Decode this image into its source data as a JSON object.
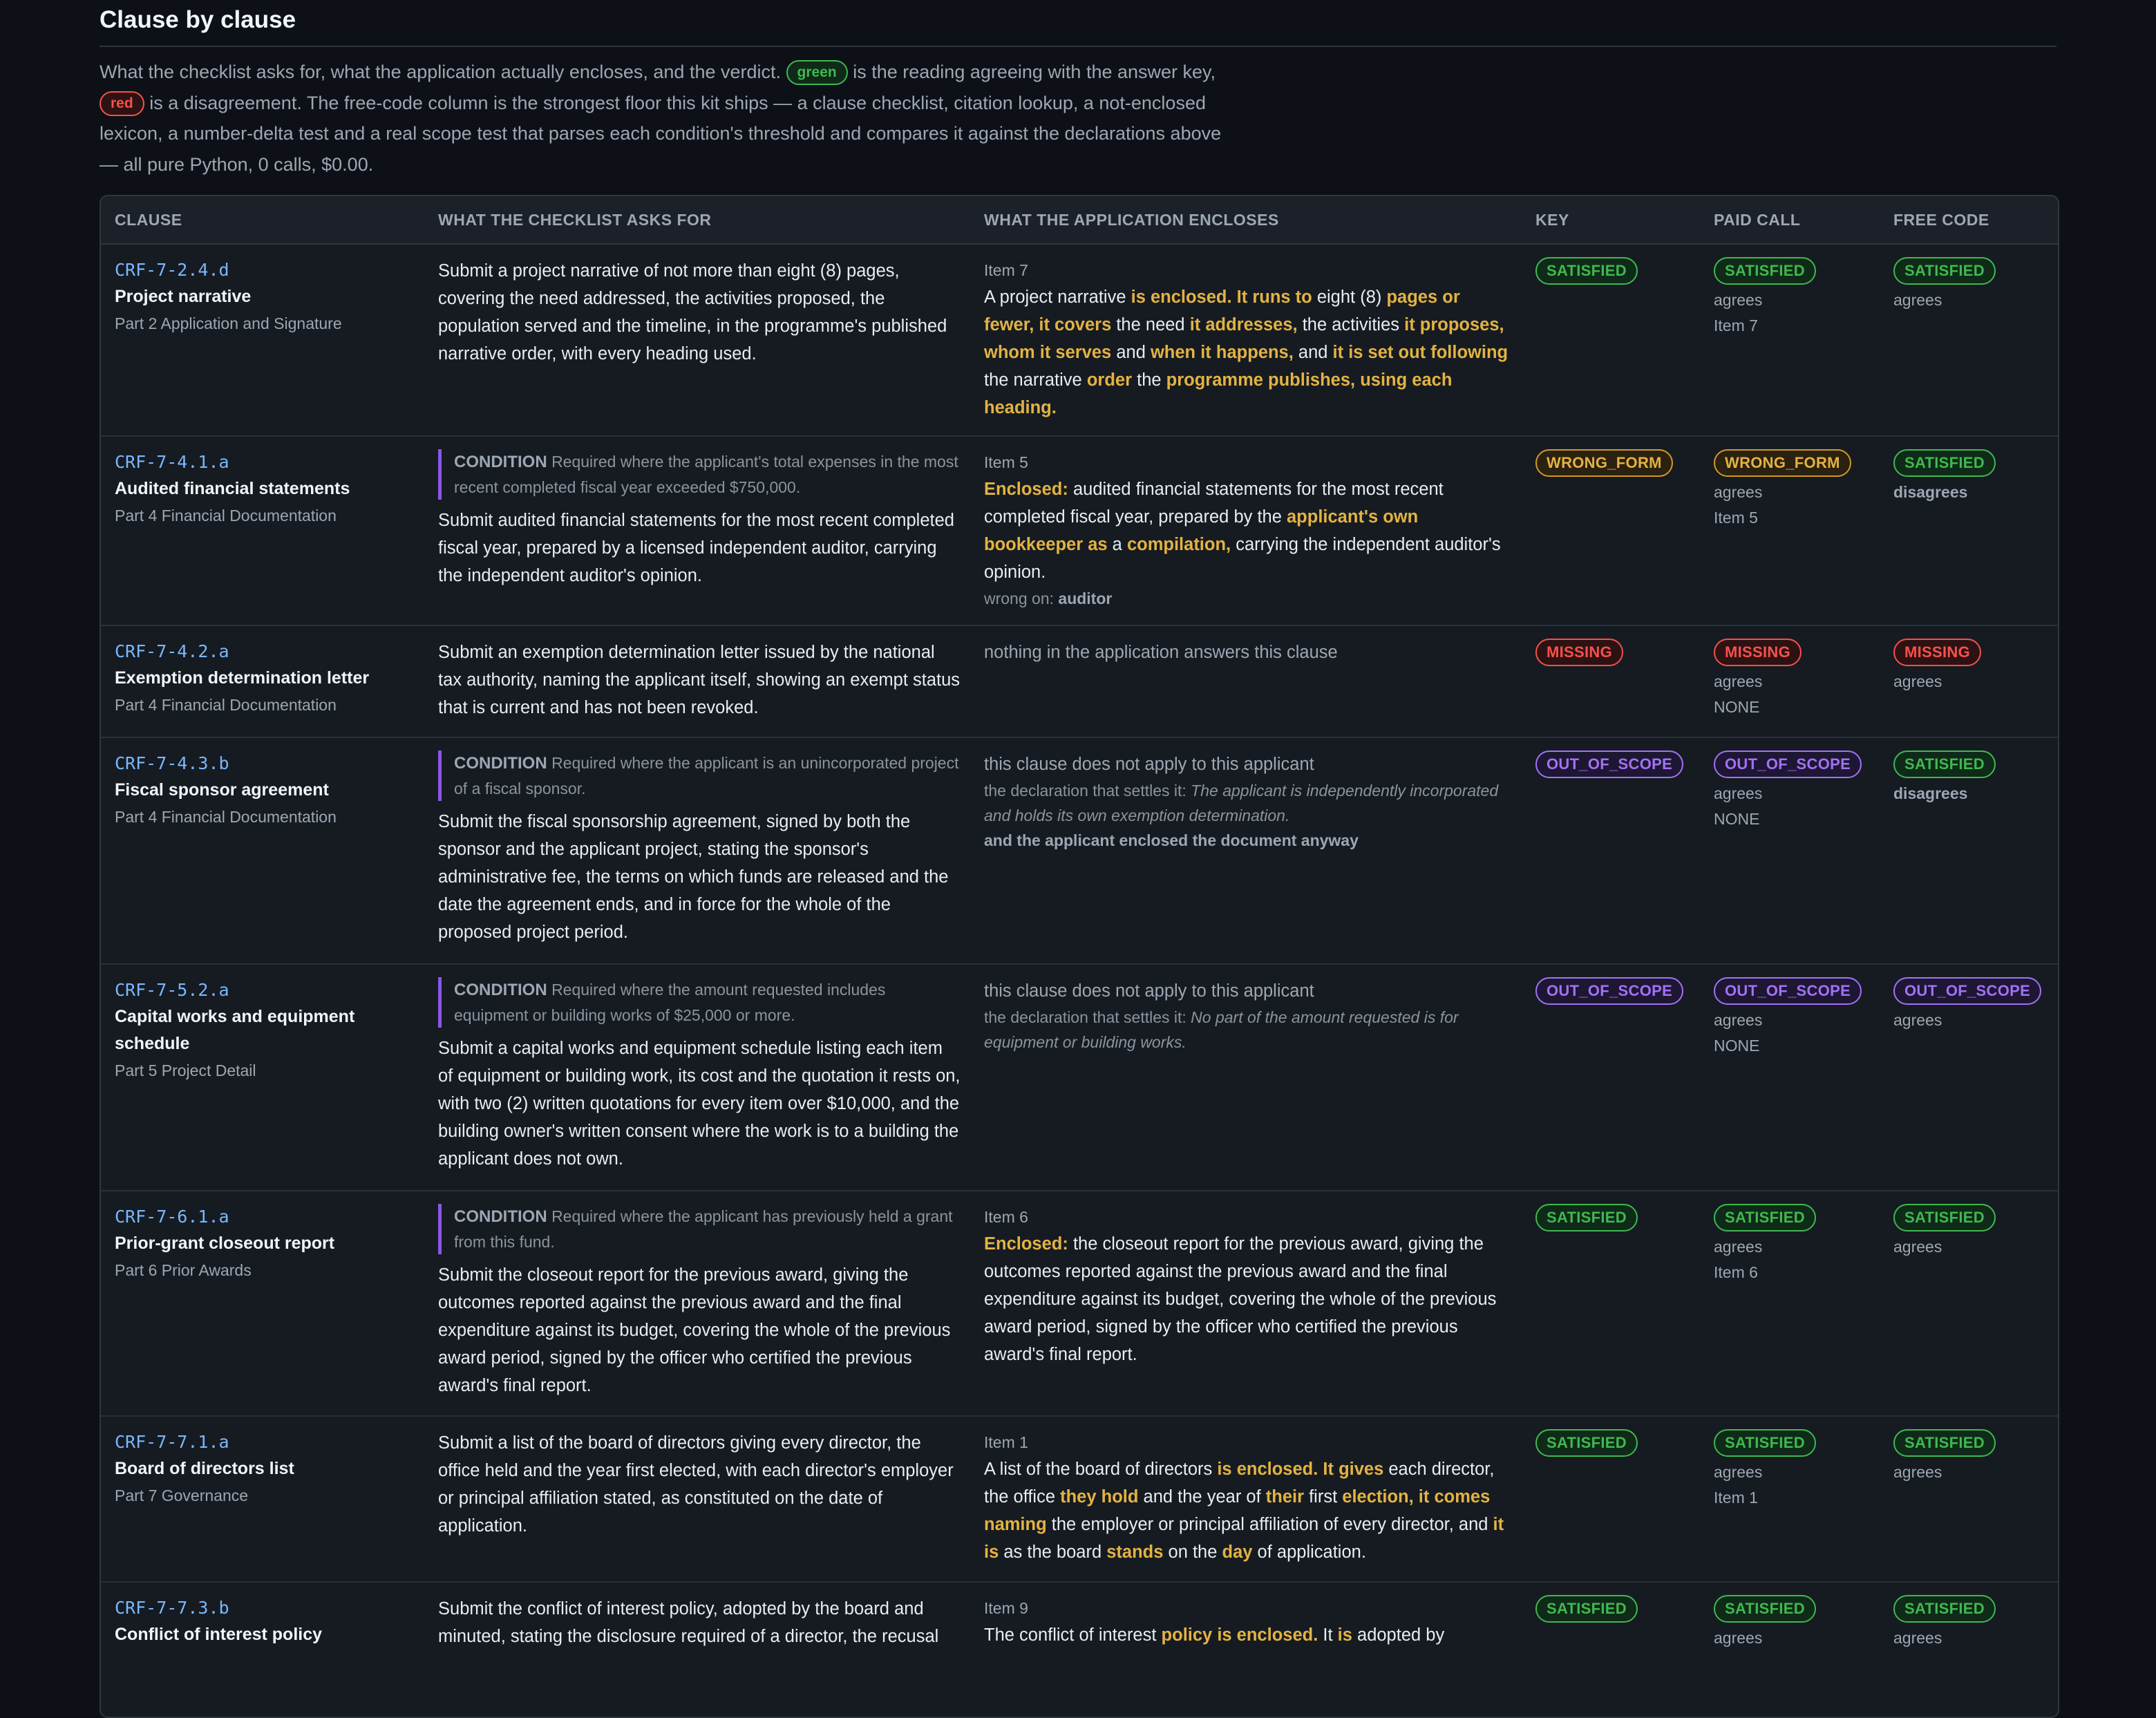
{
  "heading": "Clause by clause",
  "intro": {
    "p1": "What the checklist asks for, what the application actually encloses, and the verdict.",
    "green_chip": "green",
    "p2": "is the reading agreeing with the answer key,",
    "red_chip": "red",
    "p3": "is a disagreement. The free-code column is the strongest floor this kit ships — a clause checklist, citation lookup, a not-enclosed lexicon, a number-delta test and a real scope test that parses each condition's threshold and compares it against the declarations above — all pure Python, 0 calls, $0.00."
  },
  "columns": {
    "clause": "CLAUSE",
    "asks": "WHAT THE CHECKLIST ASKS FOR",
    "encloses": "WHAT THE APPLICATION ENCLOSES",
    "key": "KEY",
    "paid": "PAID CALL",
    "free": "FREE CODE"
  },
  "rows": [
    {
      "code": "CRF-7-2.4.d",
      "name": "Project narrative",
      "part": "Part 2 Application and Signature",
      "asks": "Submit a project narrative of not more than eight (8) pages, covering the need addressed, the activities proposed, the population served and the timeline, in the programme's published narrative order, with every heading used.",
      "item": "Item 7",
      "key": "SATISFIED",
      "paid": "SATISFIED",
      "paid_agree": "agrees",
      "paid_ref": "Item 7",
      "free": "SATISFIED",
      "free_agree": "agrees"
    },
    {
      "code": "CRF-7-4.1.a",
      "name": "Audited financial statements",
      "part": "Part 4 Financial Documentation",
      "cond_label": "CONDITION",
      "cond": "Required where the applicant's total expenses in the most recent completed fiscal year exceeded $750,000.",
      "asks": "Submit audited financial statements for the most recent completed fiscal year, prepared by a licensed independent auditor, carrying the independent auditor's opinion.",
      "item": "Item 5",
      "wrong_label": "wrong on:",
      "wrong_on": "auditor",
      "key": "WRONG_FORM",
      "paid": "WRONG_FORM",
      "paid_agree": "agrees",
      "paid_ref": "Item 5",
      "free": "SATISFIED",
      "free_agree": "disagrees"
    },
    {
      "code": "CRF-7-4.2.a",
      "name": "Exemption determination letter",
      "part": "Part 4 Financial Documentation",
      "asks": "Submit an exemption determination letter issued by the national tax authority, naming the applicant itself, showing an exempt status that is current and has not been revoked.",
      "encloses": "nothing in the application answers this clause",
      "key": "MISSING",
      "paid": "MISSING",
      "paid_agree": "agrees",
      "paid_ref": "NONE",
      "free": "MISSING",
      "free_agree": "agrees"
    },
    {
      "code": "CRF-7-4.3.b",
      "name": "Fiscal sponsor agreement",
      "part": "Part 4 Financial Documentation",
      "cond_label": "CONDITION",
      "cond": "Required where the applicant is an unincorporated project of a fiscal sponsor.",
      "asks": "Submit the fiscal sponsorship agreement, signed by both the sponsor and the applicant project, stating the sponsor's administrative fee, the terms on which funds are released and the date the agreement ends, and in force for the whole of the proposed project period.",
      "encloses": "this clause does not apply to this applicant",
      "settles_label": "the declaration that settles it:",
      "settles": "The applicant is independently incorporated and holds its own exemption determination.",
      "extra": "and the applicant enclosed the document anyway",
      "key": "OUT_OF_SCOPE",
      "paid": "OUT_OF_SCOPE",
      "paid_agree": "agrees",
      "paid_ref": "NONE",
      "free": "SATISFIED",
      "free_agree": "disagrees"
    },
    {
      "code": "CRF-7-5.2.a",
      "name": "Capital works and equipment schedule",
      "part": "Part 5 Project Detail",
      "cond_label": "CONDITION",
      "cond": "Required where the amount requested includes equipment or building works of $25,000 or more.",
      "asks": "Submit a capital works and equipment schedule listing each item of equipment or building work, its cost and the quotation it rests on, with two (2) written quotations for every item over $10,000, and the building owner's written consent where the work is to a building the applicant does not own.",
      "encloses": "this clause does not apply to this applicant",
      "settles_label": "the declaration that settles it:",
      "settles": "No part of the amount requested is for equipment or building works.",
      "key": "OUT_OF_SCOPE",
      "paid": "OUT_OF_SCOPE",
      "paid_agree": "agrees",
      "paid_ref": "NONE",
      "free": "OUT_OF_SCOPE",
      "free_agree": "agrees"
    },
    {
      "code": "CRF-7-6.1.a",
      "name": "Prior-grant closeout report",
      "part": "Part 6 Prior Awards",
      "cond_label": "CONDITION",
      "cond": "Required where the applicant has previously held a grant from this fund.",
      "asks": "Submit the closeout report for the previous award, giving the outcomes reported against the previous award and the final expenditure against its budget, covering the whole of the previous award period, signed by the officer who certified the previous award's final report.",
      "item": "Item 6",
      "enc_label": "Enclosed:",
      "encloses": "the closeout report for the previous award, giving the outcomes reported against the previous award and the final expenditure against its budget, covering the whole of the previous award period, signed by the officer who certified the previous award's final report.",
      "key": "SATISFIED",
      "paid": "SATISFIED",
      "paid_agree": "agrees",
      "paid_ref": "Item 6",
      "free": "SATISFIED",
      "free_agree": "agrees"
    },
    {
      "code": "CRF-7-7.1.a",
      "name": "Board of directors list",
      "part": "Part 7 Governance",
      "asks": "Submit a list of the board of directors giving every director, the office held and the year first elected, with each director's employer or principal affiliation stated, as constituted on the date of application.",
      "item": "Item 1",
      "key": "SATISFIED",
      "paid": "SATISFIED",
      "paid_agree": "agrees",
      "paid_ref": "Item 1",
      "free": "SATISFIED",
      "free_agree": "agrees"
    },
    {
      "code": "CRF-7-7.3.b",
      "name": "Conflict of interest policy",
      "part": "",
      "asks": "Submit the conflict of interest policy, adopted by the board and minuted, stating the disclosure required of a director, the recusal",
      "item": "Item 9",
      "key": "SATISFIED",
      "paid": "SATISFIED",
      "paid_agree": "agrees",
      "free": "SATISFIED",
      "free_agree": "agrees"
    }
  ],
  "segments": {
    "r0": [
      "A project narrative ",
      "is enclosed. It runs to",
      " eight (8) ",
      "pages or fewer, it covers",
      " the need ",
      "it addresses,",
      " the activities ",
      "it proposes, whom it serves",
      " and ",
      "when it happens,",
      " and ",
      "it is set out following",
      " the narrative ",
      "order",
      " the ",
      "programme publishes, using each heading."
    ],
    "r1": [
      "Enclosed:",
      " audited financial statements for the most recent completed fiscal year, prepared by the ",
      "applicant's own bookkeeper as",
      " a ",
      "compilation,",
      " carrying the independent auditor's opinion."
    ],
    "r6": [
      "A list of the board of directors ",
      "is enclosed. It gives",
      " each director, the office ",
      "they hold",
      " and the year of ",
      "their",
      " first ",
      "election, it comes naming",
      " the employer or principal affiliation of every director, and ",
      "it is",
      " as the board ",
      "stands",
      " on the ",
      "day",
      " of application."
    ],
    "r7": [
      "The conflict of interest ",
      "policy is enclosed.",
      " It ",
      "is",
      " adopted by"
    ]
  }
}
